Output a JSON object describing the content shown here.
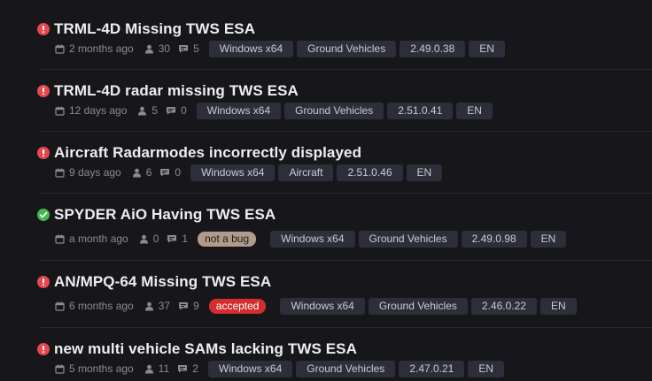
{
  "colors": {
    "background": "#17171b",
    "open_status": "#e5484d",
    "closed_status": "#3fb950",
    "tag_background": "#2c2f3a",
    "not_a_bug_badge": "#b39b8c",
    "accepted_badge": "#d42d2d"
  },
  "issues": [
    {
      "status_icon": "exclamation-circle-icon",
      "title": "TRML-4D Missing TWS ESA",
      "time": "2 months ago",
      "participants": "30",
      "comments": "5",
      "status_badge": "",
      "tags": [
        "Windows x64",
        "Ground Vehicles",
        "2.49.0.38",
        "EN"
      ]
    },
    {
      "status_icon": "exclamation-circle-icon",
      "title": "TRML-4D radar missing TWS ESA",
      "time": "12 days ago",
      "participants": "5",
      "comments": "0",
      "status_badge": "",
      "tags": [
        "Windows x64",
        "Ground Vehicles",
        "2.51.0.41",
        "EN"
      ]
    },
    {
      "status_icon": "exclamation-circle-icon",
      "title": "Aircraft Radarmodes incorrectly displayed",
      "time": "9 days ago",
      "participants": "6",
      "comments": "0",
      "status_badge": "",
      "tags": [
        "Windows x64",
        "Aircraft",
        "2.51.0.46",
        "EN"
      ]
    },
    {
      "status_icon": "check-circle-icon",
      "title": "SPYDER AiO Having TWS ESA",
      "time": "a month ago",
      "participants": "0",
      "comments": "1",
      "status_badge": "not a bug",
      "tags": [
        "Windows x64",
        "Ground Vehicles",
        "2.49.0.98",
        "EN"
      ]
    },
    {
      "status_icon": "exclamation-circle-icon",
      "title": "AN/MPQ-64 Missing TWS ESA",
      "time": "6 months ago",
      "participants": "37",
      "comments": "9",
      "status_badge": "accepted",
      "tags": [
        "Windows x64",
        "Ground Vehicles",
        "2.46.0.22",
        "EN"
      ]
    },
    {
      "status_icon": "exclamation-circle-icon",
      "title": "new multi vehicle SAMs lacking TWS ESA",
      "time": "5 months ago",
      "participants": "11",
      "comments": "2",
      "status_badge": "",
      "tags": [
        "Windows x64",
        "Ground Vehicles",
        "2.47.0.21",
        "EN"
      ]
    }
  ]
}
